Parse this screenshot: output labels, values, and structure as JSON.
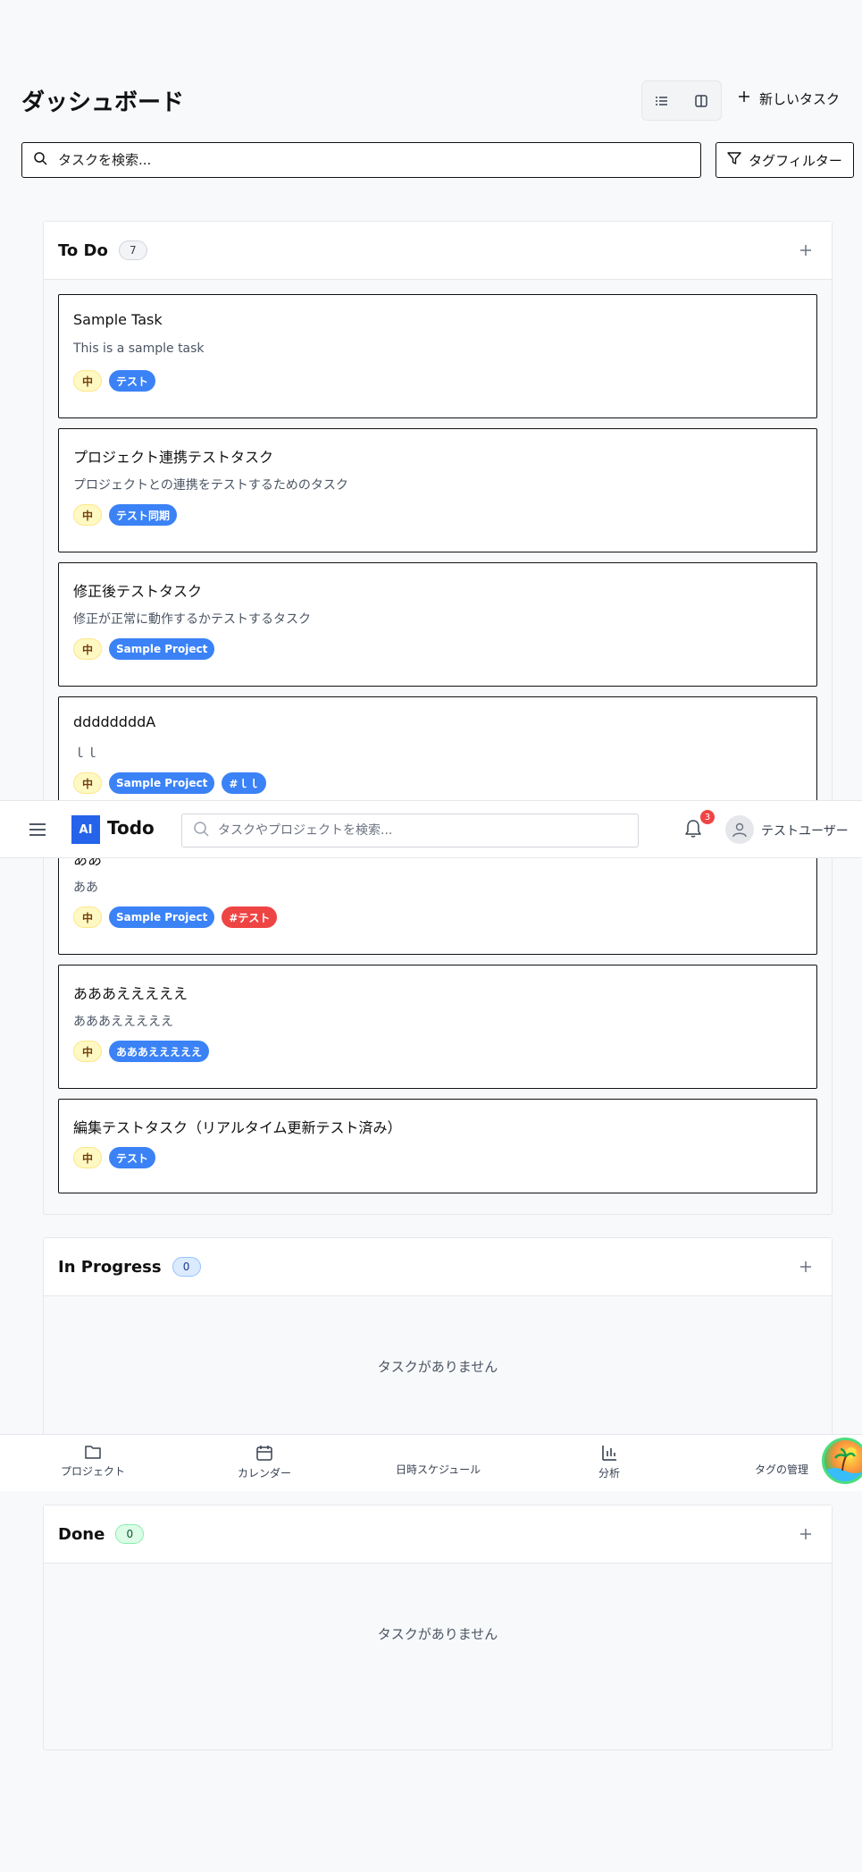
{
  "header": {
    "title": "ダッシュボード",
    "new_task_label": "新しいタスク",
    "search_placeholder": "タスクを検索...",
    "tag_filter_label": "タグフィルター"
  },
  "columns": {
    "todo": {
      "title": "To Do",
      "count": "7"
    },
    "in_progress": {
      "title": "In Progress",
      "count": "0",
      "empty_text": "タスクがありません"
    },
    "done": {
      "title": "Done",
      "count": "0",
      "empty_text": "タスクがありません"
    }
  },
  "tasks": [
    {
      "title": "Sample Task",
      "description": "This is a sample task",
      "priority": "中",
      "tags": [
        "テスト"
      ]
    },
    {
      "title": "プロジェクト連携テストタスク",
      "description": "プロジェクトとの連携をテストするためのタスク",
      "priority": "中",
      "tags": [
        "テスト同期"
      ]
    },
    {
      "title": "修正後テストタスク",
      "description": "修正が正常に動作するかテストするタスク",
      "priority": "中",
      "tags": [
        "Sample Project"
      ]
    },
    {
      "title": "ddddddddA",
      "description": "ｌｌ",
      "priority": "中",
      "tags": [
        "Sample Project",
        "#ｌｌ"
      ]
    },
    {
      "title": "ああ",
      "description": "ああ",
      "priority": "中",
      "tags": [
        "Sample Project",
        "#テスト"
      ]
    },
    {
      "title": "あああえええええ",
      "description": "あああえええええ",
      "priority": "中",
      "tags": [
        "あああえええええ"
      ]
    },
    {
      "title": "編集テストタスク（リアルタイム更新テスト済み）",
      "description": "",
      "priority": "中",
      "tags": [
        "テスト"
      ]
    }
  ],
  "top_nav": {
    "logo_mark": "AI",
    "logo_text": "Todo",
    "search_placeholder": "タスクやプロジェクトを検索...",
    "notification_count": "3",
    "user_name": "テストユーザー"
  },
  "bottom_nav": {
    "projects": "プロジェクト",
    "calendar": "カレンダー",
    "schedule": "日時スケジュール",
    "analytics": "分析",
    "tags": "タグの管理"
  },
  "colors": {
    "accent": "#2563eb",
    "tag_blue": "#3b82f6",
    "tag_red": "#ef4444",
    "priority_bg": "#fef9c3"
  }
}
